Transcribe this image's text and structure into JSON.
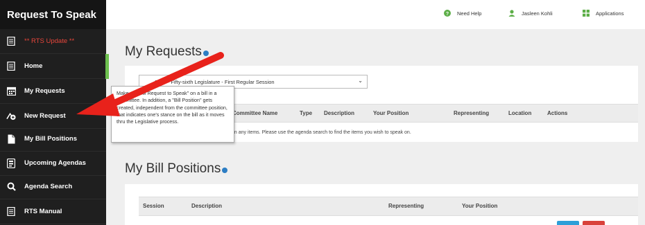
{
  "app": {
    "title": "Request To Speak"
  },
  "sidebar": {
    "items": [
      {
        "label": "** RTS Update **",
        "icon": "document-icon"
      },
      {
        "label": "Home",
        "icon": "home-icon"
      },
      {
        "label": "My Requests",
        "icon": "calendar-icon"
      },
      {
        "label": "New Request",
        "icon": "add-request-icon"
      },
      {
        "label": "My Bill Positions",
        "icon": "document-icon"
      },
      {
        "label": "Upcoming Agendas",
        "icon": "agenda-icon"
      },
      {
        "label": "Agenda Search",
        "icon": "search-icon"
      },
      {
        "label": "RTS Manual",
        "icon": "manual-icon"
      }
    ]
  },
  "topbar": {
    "help": "Need Help",
    "user": "Jasleen Kohli",
    "apps": "Applications"
  },
  "my_requests": {
    "title": "My Requests",
    "session_select": "2023 - Fifty-sixth Legislature - First Regular Session",
    "columns": [
      "Committee Name",
      "Type",
      "Description",
      "Your Position",
      "Representing",
      "Location",
      "Actions"
    ],
    "empty_note": "on any items. Please use the agenda search to find the items you wish to speak on."
  },
  "tooltip": {
    "text": "Make a \"New Request to Speak\" on a bill in a committee. In addition, a \"Bill Position\" gets created, independent from the committee position, that indicates one's stance on the bill as it moves thru the Legislative process."
  },
  "bill_positions": {
    "title": "My Bill Positions",
    "columns": [
      "Session",
      "Description",
      "Representing",
      "Your Position"
    ]
  },
  "colors": {
    "sidebar": "#1f1f1f",
    "accent_green": "#6dc04f",
    "arrow_red": "#e8221b",
    "info_blue": "#2d7ec4"
  }
}
